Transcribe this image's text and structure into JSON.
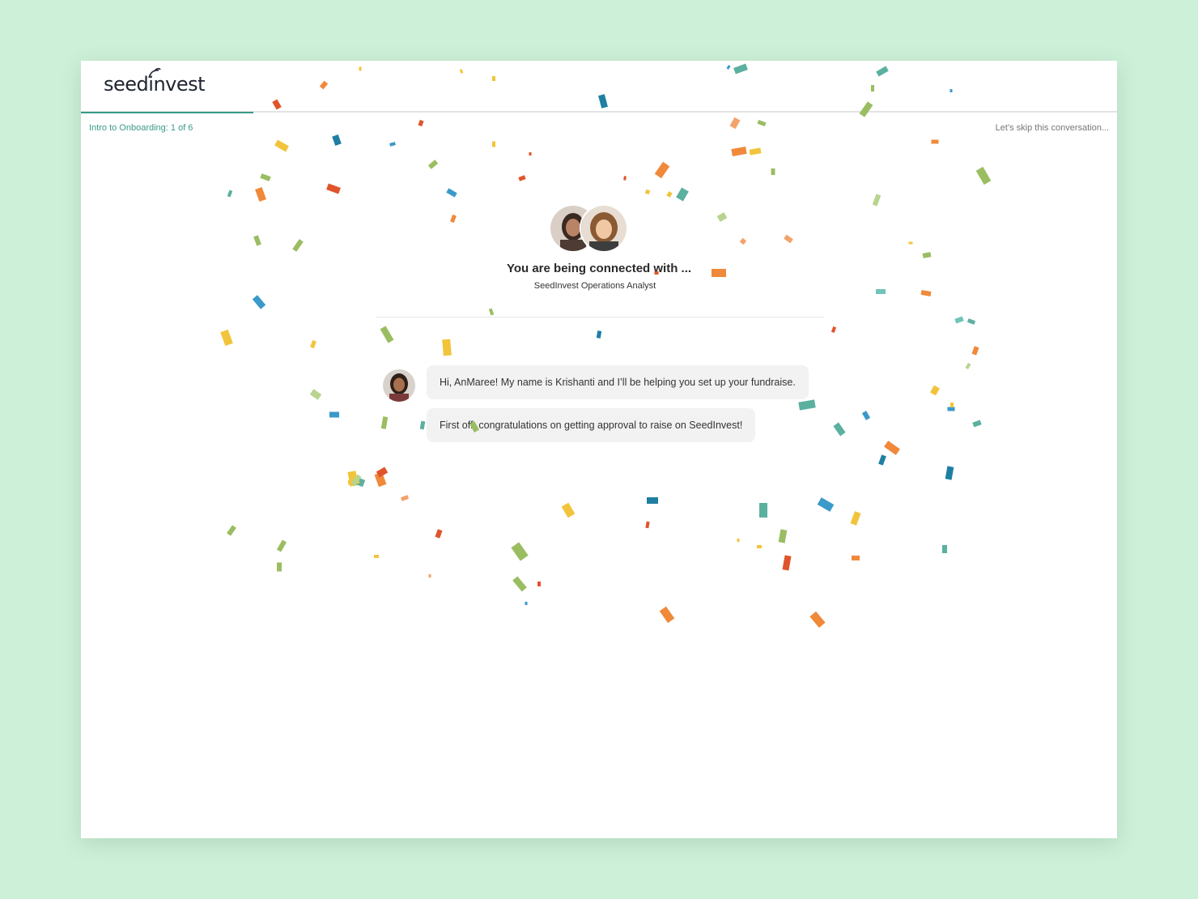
{
  "brand": {
    "name": "seedinvest"
  },
  "progress": {
    "step_label": "Intro to Onboarding: 1 of 6",
    "fraction": 0.1667
  },
  "header": {
    "skip_label": "Let’s skip this conversation..."
  },
  "connect": {
    "title": "You are being connected with ...",
    "subtitle": "SeedInvest Operations Analyst"
  },
  "chat": {
    "messages": [
      "Hi, AnMaree! My name is Krishanti and I’ll be helping you set up your fundraise.",
      "First off, congratulations on getting approval to raise on SeedInvest!"
    ]
  },
  "colors": {
    "background": "#cdf0d8",
    "accent": "#3a9a8a",
    "confetti": [
      "#e0542b",
      "#f0893a",
      "#f2c43c",
      "#9bbd62",
      "#5bb0a0",
      "#3a9ac9",
      "#1f7fa3",
      "#f3a36a",
      "#b8d48e",
      "#70c4b8"
    ]
  }
}
